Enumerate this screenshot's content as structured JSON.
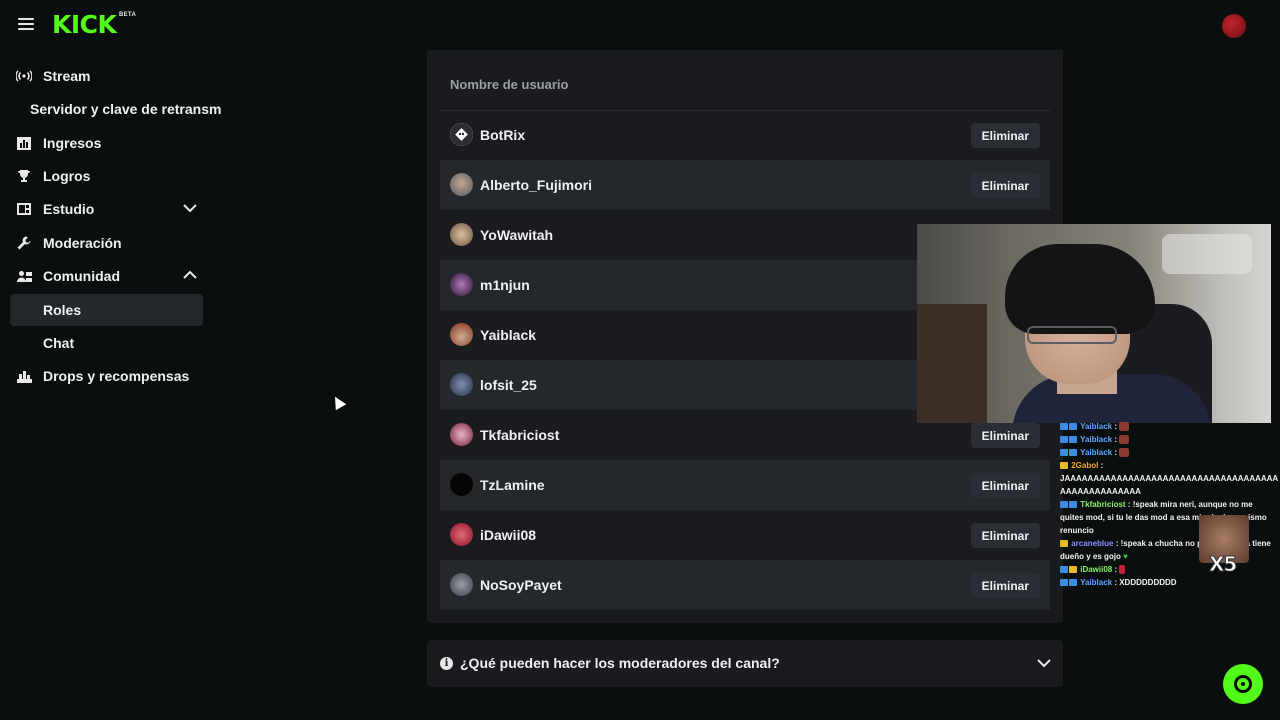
{
  "brand": {
    "logo_text": "KICK",
    "beta_label": "BETA",
    "accent": "#53fc18"
  },
  "sidebar": {
    "items": [
      {
        "label": "Stream",
        "icon": "broadcast-icon"
      },
      {
        "label": "Servidor y clave de retransm"
      },
      {
        "label": "Ingresos",
        "icon": "chart-icon"
      },
      {
        "label": "Logros",
        "icon": "trophy-icon"
      },
      {
        "label": "Estudio",
        "icon": "studio-icon",
        "expanded": false
      },
      {
        "label": "Moderación",
        "icon": "wrench-icon"
      },
      {
        "label": "Comunidad",
        "icon": "community-icon",
        "expanded": true
      },
      {
        "label": "Roles",
        "active": true
      },
      {
        "label": "Chat"
      },
      {
        "label": "Drops y recompensas",
        "icon": "gift-icon"
      }
    ]
  },
  "moderators": {
    "column_header": "Nombre de usuario",
    "remove_label": "Eliminar",
    "rows": [
      {
        "username": "BotRix"
      },
      {
        "username": "Alberto_Fujimori"
      },
      {
        "username": "YoWawitah"
      },
      {
        "username": "m1njun"
      },
      {
        "username": "Yaiblack"
      },
      {
        "username": "lofsit_25"
      },
      {
        "username": "Tkfabriciost"
      },
      {
        "username": "TzLamine"
      },
      {
        "username": "iDawii08"
      },
      {
        "username": "NoSoyPayet"
      }
    ]
  },
  "faq": {
    "question": "¿Qué pueden hacer los moderadores del canal?"
  },
  "overlay_chat": {
    "lines": [
      {
        "user": "Yaiblack",
        "text": " :"
      },
      {
        "user": "Yaiblack",
        "text": " :"
      },
      {
        "user": "Yaiblack",
        "text": " :"
      },
      {
        "user": "2Gabol",
        "text": " :"
      },
      {
        "user": "",
        "text": "JAAAAAAAAAAAAAAAAAAAAAAAAAAAAAAAAAAAAAAAAAAAAAAAAAAA"
      },
      {
        "user": "Tkfabriciost",
        "text": " : !speak mira neri, aunque no me quites mod, si tu le das mod a esa mierda de ... mismo renuncio"
      },
      {
        "user": "arcaneblue",
        "text": " : !speak a chucha no pe ... razón ya tiene dueño y es gojo"
      },
      {
        "user": "iDawii08",
        "text": " :"
      },
      {
        "user": "Yaiblack",
        "text": " : XDDDDDDDDD"
      }
    ],
    "emote_overlay_text": "X5"
  }
}
